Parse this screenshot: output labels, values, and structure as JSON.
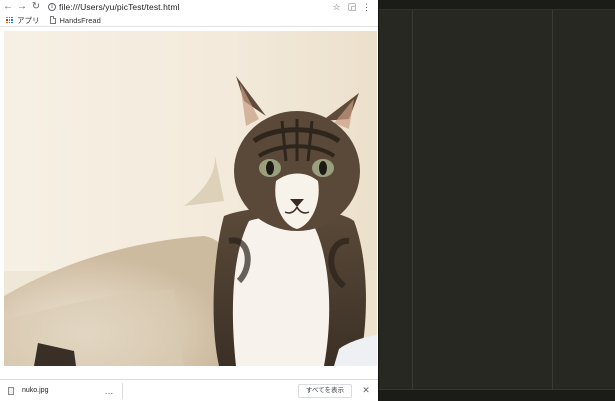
{
  "browser": {
    "nav": {
      "back_icon": "arrow-left-icon",
      "forward_icon": "arrow-right-icon",
      "reload_icon": "reload-icon"
    },
    "url": "file:///Users/yu/picTest/test.html",
    "bookmarks": [
      {
        "label": "アプリ",
        "icon": "apps-grid-icon"
      },
      {
        "label": "HandsFread",
        "icon": "page-icon"
      }
    ]
  },
  "page": {
    "image": {
      "subject": "cat",
      "filename": "nuko.jpg"
    }
  },
  "download_bar": {
    "filename": "nuko.jpg",
    "more_label": "…",
    "show_all_label": "すべてを表示",
    "close_label": "✕"
  },
  "colors": {
    "editor_bg": "#272822",
    "browser_bg": "#ffffff",
    "accent_orange": "#e37400"
  }
}
